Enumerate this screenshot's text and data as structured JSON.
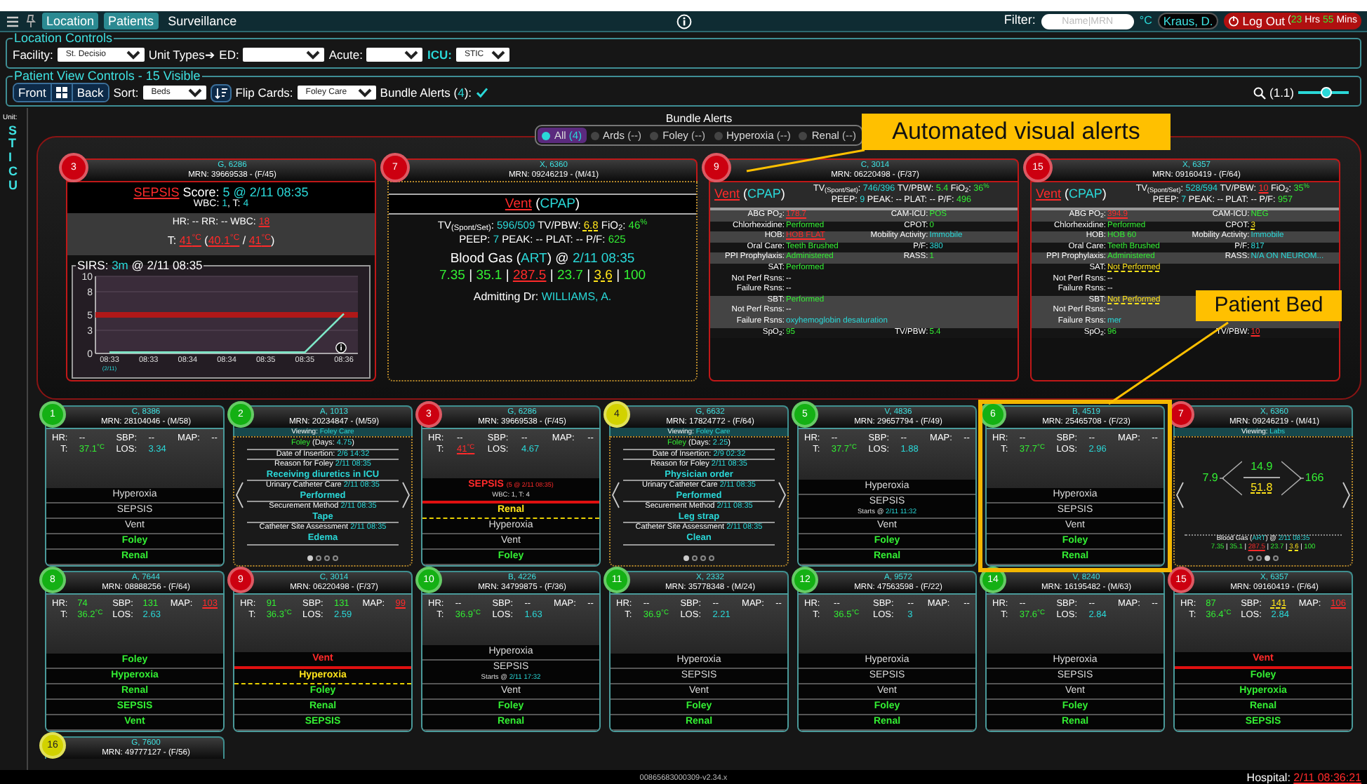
{
  "topbar": {
    "tabs": [
      {
        "label": "Location",
        "selected": true
      },
      {
        "label": "Patients",
        "selected": true
      },
      {
        "label": "Surveillance",
        "selected": false
      }
    ],
    "filter": {
      "label": "Filter:",
      "placeholder": "Name|MRN"
    },
    "temperature_unit": "°C",
    "user": "Kraus, D.",
    "logout": {
      "label": "Log Out",
      "session": [
        {
          "text": "(",
          "kind": "plain"
        },
        {
          "text": "23",
          "kind": "ok"
        },
        {
          "text": " Hrs ",
          "kind": "plain"
        },
        {
          "text": "55",
          "kind": "ok"
        },
        {
          "text": " Mins",
          "kind": "plain"
        }
      ]
    }
  },
  "location_controls": {
    "legend": "Location Controls",
    "fields": [
      {
        "label": "Facility:",
        "value": "St. Decisio",
        "highlighted": false
      },
      {
        "label": "Unit Types➔ ED:",
        "highlighted": false
      },
      {
        "label": "Acute:",
        "highlighted": false
      },
      {
        "label": "ICU:",
        "value": "STIC",
        "highlighted": true
      }
    ]
  },
  "view_controls": {
    "legend": "Patient View Controls - 15 Visible",
    "front": "Front",
    "back": "Back",
    "sort": {
      "label": "Sort:",
      "value": "Beds"
    },
    "flip": {
      "label": "Flip Cards:",
      "value": "Foley Care"
    },
    "bundle_alerts": {
      "label": [
        {
          "text": "Bundle Alerts (",
          "kind": "plain"
        },
        {
          "text": "4",
          "kind": "info"
        },
        {
          "text": "):",
          "kind": "plain"
        }
      ],
      "checked": true
    },
    "zoom": {
      "label": "(1.1)",
      "level": 0.55
    }
  },
  "unit": {
    "label": "Unit:",
    "name": "STICU"
  },
  "bundle_alerts": {
    "title": "Bundle Alerts",
    "filters": [
      {
        "label": "All",
        "count": "(4)",
        "selected": true
      },
      {
        "label": "Ards",
        "count": "(--)",
        "selected": false
      },
      {
        "label": "Foley",
        "count": "(--)",
        "selected": false
      },
      {
        "label": "Hyperoxia",
        "count": "(--)",
        "selected": false
      },
      {
        "label": "Renal",
        "count": "(--)",
        "selected": false
      }
    ],
    "cards": [
      {
        "bed": "3",
        "color": "#cc0010",
        "name": "G, 6286",
        "mrn": "MRN: 39669538 - (F/45)",
        "kind": "sepsis",
        "summary": [
          [
            {
              "text": "SEPSIS",
              "kind": "alert"
            },
            {
              "text": " Score: ",
              "kind": "plain"
            },
            {
              "text": "5 @ 2/11 08:35",
              "kind": "info"
            }
          ],
          [
            {
              "text": "WBC: ",
              "kind": "plain"
            },
            {
              "text": "1",
              "kind": "info"
            },
            {
              "text": ", T: ",
              "kind": "plain"
            },
            {
              "text": "4",
              "kind": "info"
            }
          ]
        ],
        "details": [
          [
            {
              "text": "HR: -- RR: -- WBC: ",
              "kind": "plain"
            },
            {
              "text": "18",
              "kind": "alert"
            }
          ],
          [
            {
              "text": "T: ",
              "kind": "plain"
            },
            {
              "text": "41$^{°C}$",
              "kind": "alert"
            },
            {
              "text": " (",
              "kind": "plain"
            },
            {
              "text": "40.1$^{°C}$",
              "kind": "alert"
            },
            {
              "text": " / ",
              "kind": "plain"
            },
            {
              "text": "41$^{°C}$",
              "kind": "alert"
            },
            {
              "text": ")",
              "kind": "plain"
            }
          ]
        ],
        "sirs": {
          "title": [
            {
              "text": "SIRS: ",
              "kind": "plain"
            },
            {
              "text": "3m",
              "kind": "info"
            },
            {
              "text": " @ 2/11 08:35",
              "kind": "plain"
            }
          ],
          "chart_data": {
            "type": "line",
            "xlabel": "(2/11)",
            "categories": [
              "08:33",
              "08:33",
              "08:34",
              "08:34",
              "08:35",
              "08:35",
              "08:36"
            ],
            "series": [
              {
                "color": "#7ee8c8",
                "values": [
                  0,
                  0,
                  0,
                  0,
                  0,
                  0,
                  5
                ]
              }
            ],
            "ylim": [
              0,
              10
            ],
            "yticks": [
              0,
              3,
              5,
              8,
              10
            ]
          }
        }
      },
      {
        "bed": "7",
        "color": "#cc0010",
        "name": "X, 6360",
        "mrn": "MRN: 09246219 - (M/41)",
        "kind": "vent_summary",
        "heading": [
          {
            "text": "Vent",
            "kind": "alert"
          },
          {
            "text": " (",
            "kind": "plain"
          },
          {
            "text": "CPAP",
            "kind": "info"
          },
          {
            "text": ")",
            "kind": "plain"
          }
        ],
        "settings": [
          [
            {
              "text": "TV$_{(Spont/Set)}$: ",
              "kind": "plain"
            },
            {
              "text": "596/509",
              "kind": "info"
            },
            {
              "text": " TV/PBW: ",
              "kind": "plain"
            },
            {
              "text": "6.8",
              "kind": "warn"
            },
            {
              "text": " FiO$_{2}$: ",
              "kind": "plain"
            },
            {
              "text": "46$^{%}$",
              "kind": "ok"
            }
          ],
          [
            {
              "text": "PEEP: ",
              "kind": "plain"
            },
            {
              "text": "7",
              "kind": "info"
            },
            {
              "text": " PEAK: -- PLAT: -- P/F: ",
              "kind": "plain"
            },
            {
              "text": "625",
              "kind": "ok"
            }
          ]
        ],
        "blood_gas": {
          "title": [
            {
              "text": "Blood Gas (",
              "kind": "plain"
            },
            {
              "text": "ART",
              "kind": "info"
            },
            {
              "text": ") @ ",
              "kind": "plain"
            },
            {
              "text": "2/11 08:35",
              "kind": "info"
            }
          ],
          "values": [
            {
              "text": "7.35",
              "kind": "ok"
            },
            {
              "text": " | ",
              "kind": "plain"
            },
            {
              "text": "35.1",
              "kind": "ok"
            },
            {
              "text": " | ",
              "kind": "plain"
            },
            {
              "text": "287.5",
              "kind": "alert"
            },
            {
              "text": " | ",
              "kind": "plain"
            },
            {
              "text": "23.7",
              "kind": "ok"
            },
            {
              "text": " | ",
              "kind": "plain"
            },
            {
              "text": "3.6",
              "kind": "warn"
            },
            {
              "text": " | ",
              "kind": "plain"
            },
            {
              "text": "100",
              "kind": "ok"
            }
          ]
        },
        "admitting": [
          {
            "text": "Admitting Dr: ",
            "kind": "plain"
          },
          {
            "text": "WILLIAMS, A.",
            "kind": "info"
          }
        ]
      },
      {
        "bed": "9",
        "color": "#cc0010",
        "name": "C, 3014",
        "mrn": "MRN: 06220498 - (F/37)",
        "kind": "vent_bundle",
        "heading": [
          {
            "text": "Vent",
            "kind": "alert"
          },
          {
            "text": " (",
            "kind": "plain"
          },
          {
            "text": "CPAP",
            "kind": "info"
          },
          {
            "text": ")",
            "kind": "plain"
          }
        ],
        "settings": [
          [
            {
              "text": "TV$_{(Spont/Set)}$: ",
              "kind": "plain"
            },
            {
              "text": "746/396",
              "kind": "info"
            },
            {
              "text": " TV/PBW: ",
              "kind": "plain"
            },
            {
              "text": "5.4",
              "kind": "ok"
            },
            {
              "text": " FiO$_{2}$: ",
              "kind": "plain"
            },
            {
              "text": "36$^{%}$",
              "kind": "ok"
            }
          ],
          [
            {
              "text": "PEEP: ",
              "kind": "plain"
            },
            {
              "text": "9",
              "kind": "info"
            },
            {
              "text": " PEAK: -- PLAT: -- P/F: ",
              "kind": "plain"
            },
            {
              "text": "496",
              "kind": "ok"
            }
          ]
        ],
        "sections": [
          [
            [
              {
                "label": "ABG PO$_{2}$:",
                "value": "178.7",
                "kind": "alert"
              },
              {
                "label": "CAM-ICU:",
                "value": "POS",
                "kind": "ok"
              }
            ]
          ],
          [
            [
              {
                "label": "Chlorhexidine:",
                "value": "Performed",
                "kind": "ok"
              },
              {
                "label": "CPOT:",
                "value": "0",
                "kind": "ok"
              }
            ]
          ],
          [
            [
              {
                "label": "HOB:",
                "value": "HOB FLAT",
                "kind": "alert"
              },
              {
                "label": "Mobility Activity:",
                "value": "Immobile",
                "kind": "info"
              }
            ]
          ],
          [
            [
              {
                "label": "Oral Care:",
                "value": "Teeth Brushed",
                "kind": "ok"
              },
              {
                "label": "P/F:",
                "value": "380",
                "kind": "info"
              }
            ]
          ],
          [
            [
              {
                "label": "PPI Prophylaxis:",
                "value": "Administered",
                "kind": "ok"
              },
              {
                "label": "RASS:",
                "value": "1",
                "kind": "ok"
              }
            ]
          ],
          [
            [
              {
                "label": "SAT:",
                "value": "Performed",
                "kind": "ok"
              }
            ],
            [
              {
                "label": "Not Perf Rsns:",
                "value": "--",
                "kind": "plain"
              }
            ],
            [
              {
                "label": "Failure Rsns:",
                "value": "--",
                "kind": "plain"
              }
            ]
          ],
          [
            [
              {
                "label": "SBT:",
                "value": "Performed",
                "kind": "ok"
              }
            ],
            [
              {
                "label": "Not Perf Rsns:",
                "value": "--",
                "kind": "plain"
              }
            ],
            [
              {
                "label": "Failure Rsns:",
                "value": "oxyhemoglobin desaturation",
                "kind": "info"
              }
            ]
          ],
          [
            [
              {
                "label": "SpO$_{2}$:",
                "value": "95",
                "kind": "ok"
              },
              {
                "label": "TV/PBW:",
                "value": "5.4",
                "kind": "ok"
              }
            ]
          ]
        ]
      },
      {
        "bed": "15",
        "color": "#cc0010",
        "name": "X, 6357",
        "mrn": "MRN: 09160419 - (F/64)",
        "kind": "vent_bundle",
        "heading": [
          {
            "text": "Vent",
            "kind": "alert"
          },
          {
            "text": " (",
            "kind": "plain"
          },
          {
            "text": "CPAP",
            "kind": "info"
          },
          {
            "text": ")",
            "kind": "plain"
          }
        ],
        "settings": [
          [
            {
              "text": "TV$_{(Spont/Set)}$: ",
              "kind": "plain"
            },
            {
              "text": "528/594",
              "kind": "info"
            },
            {
              "text": " TV/PBW: ",
              "kind": "plain"
            },
            {
              "text": "10",
              "kind": "alert"
            },
            {
              "text": " FiO$_{2}$: ",
              "kind": "plain"
            },
            {
              "text": "35$^{%}$",
              "kind": "ok"
            }
          ],
          [
            {
              "text": "PEEP: ",
              "kind": "plain"
            },
            {
              "text": "7",
              "kind": "info"
            },
            {
              "text": " PEAK: -- PLAT: -- P/F: ",
              "kind": "plain"
            },
            {
              "text": "957",
              "kind": "ok"
            }
          ]
        ],
        "sections": [
          [
            [
              {
                "label": "ABG PO$_{2}$:",
                "value": "394.9",
                "kind": "alert"
              },
              {
                "label": "CAM-ICU:",
                "value": "NEG",
                "kind": "ok"
              }
            ]
          ],
          [
            [
              {
                "label": "Chlorhexidine:",
                "value": "Performed",
                "kind": "ok"
              },
              {
                "label": "CPOT:",
                "value": "3",
                "kind": "warn"
              }
            ]
          ],
          [
            [
              {
                "label": "HOB:",
                "value": "HOB 60",
                "kind": "ok"
              },
              {
                "label": "Mobility Activity:",
                "value": "Immobile",
                "kind": "info"
              }
            ]
          ],
          [
            [
              {
                "label": "Oral Care:",
                "value": "Teeth Brushed",
                "kind": "ok"
              },
              {
                "label": "P/F:",
                "value": "817",
                "kind": "info"
              }
            ]
          ],
          [
            [
              {
                "label": "PPI Prophylaxis:",
                "value": "Administered",
                "kind": "ok"
              },
              {
                "label": "RASS:",
                "value": "N/A ON NEUROM...",
                "kind": "info"
              }
            ]
          ],
          [
            [
              {
                "label": "SAT:",
                "value": "Not Performed",
                "kind": "warn"
              }
            ],
            [
              {
                "label": "Not Perf Rsns:",
                "value": "--",
                "kind": "plain"
              }
            ],
            [
              {
                "label": "Failure Rsns:",
                "value": "--",
                "kind": "plain"
              }
            ]
          ],
          [
            [
              {
                "label": "SBT:",
                "value": "Not Performed",
                "kind": "warn"
              }
            ],
            [
              {
                "label": "Not Perf Rsns:",
                "value": "--",
                "kind": "plain"
              }
            ],
            [
              {
                "label": "Failure Rsns:",
                "value": "mer",
                "kind": "info"
              }
            ]
          ],
          [
            [
              {
                "label": "SpO$_{2}$:",
                "value": "96",
                "kind": "ok"
              },
              {
                "label": "TV/PBW:",
                "value": "10",
                "kind": "alert"
              }
            ]
          ]
        ]
      }
    ]
  },
  "patients": [
    {
      "bed": "1",
      "color": "#14b014",
      "name": "C, 8386",
      "mrn": "MRN: 28104046 - (M/58)",
      "highlighted": false,
      "kind": "vitals",
      "vitals": [
        {
          "label": "HR:",
          "value": "--",
          "kind": "plain"
        },
        {
          "label": "SBP:",
          "value": "--",
          "kind": "plain"
        },
        {
          "label": "MAP:",
          "value": "--",
          "kind": "plain"
        },
        {
          "label": "T:",
          "value": "37.1$^{°C}$",
          "kind": "ok"
        },
        {
          "label": "LOS:",
          "value": "3.34",
          "kind": "info"
        }
      ],
      "alerts": [
        {
          "text": "Hyperoxia",
          "kind": "plain"
        },
        {
          "text": "SEPSIS",
          "kind": "plain"
        },
        {
          "text": "Vent",
          "kind": "plain"
        },
        {
          "text": "Foley",
          "kind": "ok"
        },
        {
          "text": "Renal",
          "kind": "ok"
        }
      ]
    },
    {
      "bed": "2",
      "color": "#14b014",
      "name": "A, 1013",
      "mrn": "MRN: 20234847 - (M/59)",
      "highlighted": false,
      "viewing": [
        {
          "text": "Viewing: ",
          "kind": "plain"
        },
        {
          "text": "Foley Care",
          "kind": "info"
        }
      ],
      "kind": "foley",
      "entries": [
        {
          "label": [
            {
              "text": "Foley",
              "kind": "ok"
            },
            {
              "text": " (Days: ",
              "kind": "plain"
            },
            {
              "text": "4.75",
              "kind": "info"
            },
            {
              "text": ")",
              "kind": "plain"
            }
          ]
        },
        {
          "label": [
            {
              "text": "Date of Insertion: ",
              "kind": "plain"
            },
            {
              "text": "2/6 14:32",
              "kind": "info"
            }
          ]
        },
        {
          "label": [
            {
              "text": "Reason for Foley ",
              "kind": "plain"
            },
            {
              "text": "2/11 08:35",
              "kind": "info"
            }
          ],
          "value": "Receiving diuretics in ICU"
        },
        {
          "label": [
            {
              "text": "Urinary Catheter Care ",
              "kind": "plain"
            },
            {
              "text": "2/11 08:35",
              "kind": "info"
            }
          ],
          "value": "Performed"
        },
        {
          "label": [
            {
              "text": "Securement Method ",
              "kind": "plain"
            },
            {
              "text": "2/11 08:35",
              "kind": "info"
            }
          ],
          "value": "Tape"
        },
        {
          "label": [
            {
              "text": "Catheter Site Assessment ",
              "kind": "plain"
            },
            {
              "text": "2/11 08:35",
              "kind": "info"
            }
          ],
          "value": "Edema"
        }
      ],
      "pages": [
        {
          "selected": true
        },
        {
          "selected": false
        },
        {
          "selected": false
        },
        {
          "selected": false
        }
      ]
    },
    {
      "bed": "3",
      "color": "#cc0010",
      "name": "G, 6286",
      "mrn": "MRN: 39669538 - (F/45)",
      "highlighted": false,
      "kind": "vitals",
      "vitals": [
        {
          "label": "HR:",
          "value": "--",
          "kind": "plain"
        },
        {
          "label": "SBP:",
          "value": "--",
          "kind": "plain"
        },
        {
          "label": "MAP:",
          "value": "--",
          "kind": "plain"
        },
        {
          "label": "T:",
          "value": "41$^{°C}$",
          "kind": "alert"
        },
        {
          "label": "LOS:",
          "value": "4.67",
          "kind": "info"
        }
      ],
      "alerts": [
        {
          "text": "SEPSIS",
          "kind": "alert",
          "note": "(5 @ 2/11 08:35)",
          "detail": [
            {
              "text": "WBC: 1, T: 4",
              "kind": "plain"
            }
          ]
        },
        {
          "text": "Renal",
          "kind": "warn"
        },
        {
          "text": "Hyperoxia",
          "kind": "plain"
        },
        {
          "text": "Vent",
          "kind": "plain"
        },
        {
          "text": "Foley",
          "kind": "ok"
        }
      ]
    },
    {
      "bed": "4",
      "color": "#d2d200",
      "name": "G, 6632",
      "mrn": "MRN: 17824772 - (F/64)",
      "highlighted": false,
      "viewing": [
        {
          "text": "Viewing: ",
          "kind": "plain"
        },
        {
          "text": "Foley Care",
          "kind": "info"
        }
      ],
      "kind": "foley",
      "entries": [
        {
          "label": [
            {
              "text": "Foley",
              "kind": "ok"
            },
            {
              "text": " (Days: ",
              "kind": "plain"
            },
            {
              "text": "2.25",
              "kind": "info"
            },
            {
              "text": ")",
              "kind": "plain"
            }
          ]
        },
        {
          "label": [
            {
              "text": "Date of Insertion: ",
              "kind": "plain"
            },
            {
              "text": "2/9 02:32",
              "kind": "info"
            }
          ]
        },
        {
          "label": [
            {
              "text": "Reason for Foley ",
              "kind": "plain"
            },
            {
              "text": "2/11 08:35",
              "kind": "info"
            }
          ],
          "value": "Physician order"
        },
        {
          "label": [
            {
              "text": "Urinary Catheter Care ",
              "kind": "plain"
            },
            {
              "text": "2/11 08:35",
              "kind": "info"
            }
          ],
          "value": "Performed"
        },
        {
          "label": [
            {
              "text": "Securement Method ",
              "kind": "plain"
            },
            {
              "text": "2/11 08:35",
              "kind": "info"
            }
          ],
          "value": "Leg strap"
        },
        {
          "label": [
            {
              "text": "Catheter Site Assessment ",
              "kind": "plain"
            },
            {
              "text": "2/11 08:35",
              "kind": "info"
            }
          ],
          "value": "Clean"
        }
      ],
      "pages": [
        {
          "selected": true
        },
        {
          "selected": false
        },
        {
          "selected": false
        },
        {
          "selected": false
        }
      ]
    },
    {
      "bed": "5",
      "color": "#14b014",
      "name": "V, 4836",
      "mrn": "MRN: 29657794 - (F/49)",
      "highlighted": false,
      "kind": "vitals",
      "vitals": [
        {
          "label": "HR:",
          "value": "--",
          "kind": "plain"
        },
        {
          "label": "SBP:",
          "value": "--",
          "kind": "plain"
        },
        {
          "label": "MAP:",
          "value": "--",
          "kind": "plain"
        },
        {
          "label": "T:",
          "value": "37.7$^{°C}$",
          "kind": "ok"
        },
        {
          "label": "LOS:",
          "value": "1.88",
          "kind": "info"
        }
      ],
      "alerts": [
        {
          "text": "Hyperoxia",
          "kind": "plain"
        },
        {
          "text": "SEPSIS",
          "kind": "plain",
          "detail": [
            {
              "text": "Starts @ ",
              "kind": "plain"
            },
            {
              "text": "2/11 11:32",
              "kind": "info"
            }
          ]
        },
        {
          "text": "Vent",
          "kind": "plain"
        },
        {
          "text": "Foley",
          "kind": "ok"
        },
        {
          "text": "Renal",
          "kind": "ok"
        }
      ]
    },
    {
      "bed": "6",
      "color": "#14b014",
      "name": "B, 4519",
      "mrn": "MRN: 25465708 - (F/23)",
      "highlighted": true,
      "kind": "vitals",
      "vitals": [
        {
          "label": "HR:",
          "value": "--",
          "kind": "plain"
        },
        {
          "label": "SBP:",
          "value": "--",
          "kind": "plain"
        },
        {
          "label": "MAP:",
          "value": "--",
          "kind": "plain"
        },
        {
          "label": "T:",
          "value": "37.7$^{°C}$",
          "kind": "ok"
        },
        {
          "label": "LOS:",
          "value": "2.96",
          "kind": "info"
        }
      ],
      "alerts": [
        {
          "text": "Hyperoxia",
          "kind": "plain"
        },
        {
          "text": "SEPSIS",
          "kind": "plain"
        },
        {
          "text": "Vent",
          "kind": "plain"
        },
        {
          "text": "Foley",
          "kind": "ok"
        },
        {
          "text": "Renal",
          "kind": "ok"
        }
      ]
    },
    {
      "bed": "7",
      "color": "#cc0010",
      "name": "X, 6360",
      "mrn": "MRN: 09246219 - (M/41)",
      "highlighted": false,
      "viewing": [
        {
          "text": "Viewing: ",
          "kind": "plain"
        },
        {
          "text": "Labs",
          "kind": "info"
        }
      ],
      "kind": "labs",
      "labs": {
        "left": {
          "text": "7.9",
          "kind": "ok"
        },
        "top": {
          "text": "14.9",
          "kind": "ok"
        },
        "bottom": {
          "text": "51.8",
          "kind": "warn"
        },
        "right": {
          "text": "166",
          "kind": "ok"
        }
      },
      "blood_gas": {
        "title": [
          {
            "text": "Blood Gas (",
            "kind": "plain"
          },
          {
            "text": "ART",
            "kind": "info"
          },
          {
            "text": ") @ ",
            "kind": "plain"
          },
          {
            "text": "2/11 08:35",
            "kind": "info"
          }
        ],
        "values": [
          {
            "text": "7.35",
            "kind": "ok"
          },
          {
            "text": " | ",
            "kind": "plain"
          },
          {
            "text": "35.1",
            "kind": "ok"
          },
          {
            "text": " | ",
            "kind": "plain"
          },
          {
            "text": "287.5",
            "kind": "alert"
          },
          {
            "text": " | ",
            "kind": "plain"
          },
          {
            "text": "23.7",
            "kind": "ok"
          },
          {
            "text": " | ",
            "kind": "plain"
          },
          {
            "text": "3.6",
            "kind": "warn"
          },
          {
            "text": " | ",
            "kind": "plain"
          },
          {
            "text": "100",
            "kind": "ok"
          }
        ]
      },
      "pages": [
        {
          "selected": false
        },
        {
          "selected": false
        },
        {
          "selected": true
        },
        {
          "selected": false
        }
      ]
    },
    {
      "bed": "8",
      "color": "#14b014",
      "name": "A, 7644",
      "mrn": "MRN: 08888256 - (F/64)",
      "highlighted": false,
      "kind": "vitals",
      "vitals": [
        {
          "label": "HR:",
          "value": "74",
          "kind": "ok"
        },
        {
          "label": "SBP:",
          "value": "131",
          "kind": "ok"
        },
        {
          "label": "MAP:",
          "value": "103",
          "kind": "alert"
        },
        {
          "label": "T:",
          "value": "36.2$^{°C}$",
          "kind": "ok"
        },
        {
          "label": "LOS:",
          "value": "2.63",
          "kind": "info"
        }
      ],
      "alerts": [
        {
          "text": "Foley",
          "kind": "ok"
        },
        {
          "text": "Hyperoxia",
          "kind": "ok"
        },
        {
          "text": "Renal",
          "kind": "ok"
        },
        {
          "text": "SEPSIS",
          "kind": "ok"
        },
        {
          "text": "Vent",
          "kind": "ok"
        }
      ]
    },
    {
      "bed": "9",
      "color": "#cc0010",
      "name": "C, 3014",
      "mrn": "MRN: 06220498 - (F/37)",
      "highlighted": false,
      "kind": "vitals",
      "vitals": [
        {
          "label": "HR:",
          "value": "91",
          "kind": "ok"
        },
        {
          "label": "SBP:",
          "value": "131",
          "kind": "ok"
        },
        {
          "label": "MAP:",
          "value": "99",
          "kind": "alert"
        },
        {
          "label": "T:",
          "value": "36.3$^{°C}$",
          "kind": "ok"
        },
        {
          "label": "LOS:",
          "value": "2.59",
          "kind": "info"
        }
      ],
      "alerts": [
        {
          "text": "Vent",
          "kind": "alert"
        },
        {
          "text": "Hyperoxia",
          "kind": "warn"
        },
        {
          "text": "Foley",
          "kind": "ok"
        },
        {
          "text": "Renal",
          "kind": "ok"
        },
        {
          "text": "SEPSIS",
          "kind": "ok"
        }
      ]
    },
    {
      "bed": "10",
      "color": "#14b014",
      "name": "B, 4226",
      "mrn": "MRN: 34799875 - (F/36)",
      "highlighted": false,
      "kind": "vitals",
      "vitals": [
        {
          "label": "HR:",
          "value": "--",
          "kind": "plain"
        },
        {
          "label": "SBP:",
          "value": "--",
          "kind": "plain"
        },
        {
          "label": "MAP:",
          "value": "--",
          "kind": "plain"
        },
        {
          "label": "T:",
          "value": "36.9$^{°C}$",
          "kind": "ok"
        },
        {
          "label": "LOS:",
          "value": "1.63",
          "kind": "info"
        }
      ],
      "alerts": [
        {
          "text": "Hyperoxia",
          "kind": "plain"
        },
        {
          "text": "SEPSIS",
          "kind": "plain",
          "detail": [
            {
              "text": "Starts @ ",
              "kind": "plain"
            },
            {
              "text": "2/11 17:32",
              "kind": "info"
            }
          ]
        },
        {
          "text": "Vent",
          "kind": "plain"
        },
        {
          "text": "Foley",
          "kind": "ok"
        },
        {
          "text": "Renal",
          "kind": "ok"
        }
      ]
    },
    {
      "bed": "11",
      "color": "#14b014",
      "name": "X, 2332",
      "mrn": "MRN: 35778348 - (M/24)",
      "highlighted": false,
      "kind": "vitals",
      "vitals": [
        {
          "label": "HR:",
          "value": "--",
          "kind": "plain"
        },
        {
          "label": "SBP:",
          "value": "--",
          "kind": "plain"
        },
        {
          "label": "MAP:",
          "value": "--",
          "kind": "plain"
        },
        {
          "label": "T:",
          "value": "36.9$^{°C}$",
          "kind": "ok"
        },
        {
          "label": "LOS:",
          "value": "2.21",
          "kind": "info"
        }
      ],
      "alerts": [
        {
          "text": "Hyperoxia",
          "kind": "plain"
        },
        {
          "text": "SEPSIS",
          "kind": "plain"
        },
        {
          "text": "Vent",
          "kind": "plain"
        },
        {
          "text": "Foley",
          "kind": "ok"
        },
        {
          "text": "Renal",
          "kind": "ok"
        }
      ]
    },
    {
      "bed": "12",
      "color": "#14b014",
      "name": "A, 9572",
      "mrn": "MRN: 47563598 - (F/22)",
      "highlighted": false,
      "kind": "vitals",
      "vitals": [
        {
          "label": "HR:",
          "value": "--",
          "kind": "plain"
        },
        {
          "label": "SBP:",
          "value": "--",
          "kind": "plain"
        },
        {
          "label": "MAP:",
          "value": "--",
          "kind": "plain"
        },
        {
          "label": "T:",
          "value": "36.5$^{°C}$",
          "kind": "ok"
        },
        {
          "label": "LOS:",
          "value": "3",
          "kind": "info"
        }
      ],
      "alerts": [
        {
          "text": "Hyperoxia",
          "kind": "plain"
        },
        {
          "text": "SEPSIS",
          "kind": "plain"
        },
        {
          "text": "Vent",
          "kind": "plain"
        },
        {
          "text": "Foley",
          "kind": "ok"
        },
        {
          "text": "Renal",
          "kind": "ok"
        }
      ]
    },
    {
      "bed": "14",
      "color": "#14b014",
      "name": "V, 8240",
      "mrn": "MRN: 16195482 - (M/63)",
      "highlighted": false,
      "kind": "vitals",
      "vitals": [
        {
          "label": "HR:",
          "value": "--",
          "kind": "plain"
        },
        {
          "label": "SBP:",
          "value": "--",
          "kind": "plain"
        },
        {
          "label": "MAP:",
          "value": "--",
          "kind": "plain"
        },
        {
          "label": "T:",
          "value": "37.6$^{°C}$",
          "kind": "ok"
        },
        {
          "label": "LOS:",
          "value": "2.84",
          "kind": "info"
        }
      ],
      "alerts": [
        {
          "text": "Hyperoxia",
          "kind": "plain"
        },
        {
          "text": "SEPSIS",
          "kind": "plain"
        },
        {
          "text": "Vent",
          "kind": "plain"
        },
        {
          "text": "Foley",
          "kind": "ok"
        },
        {
          "text": "Renal",
          "kind": "ok"
        }
      ]
    },
    {
      "bed": "15",
      "color": "#cc0010",
      "name": "X, 6357",
      "mrn": "MRN: 09160419 - (F/64)",
      "highlighted": false,
      "kind": "vitals",
      "vitals": [
        {
          "label": "HR:",
          "value": "87",
          "kind": "ok"
        },
        {
          "label": "SBP:",
          "value": "141",
          "kind": "warn"
        },
        {
          "label": "MAP:",
          "value": "106",
          "kind": "alert"
        },
        {
          "label": "T:",
          "value": "36.4$^{°C}$",
          "kind": "ok"
        },
        {
          "label": "LOS:",
          "value": "2.84",
          "kind": "info"
        }
      ],
      "alerts": [
        {
          "text": "Vent",
          "kind": "alert"
        },
        {
          "text": "Foley",
          "kind": "ok"
        },
        {
          "text": "Hyperoxia",
          "kind": "ok"
        },
        {
          "text": "Renal",
          "kind": "ok"
        },
        {
          "text": "SEPSIS",
          "kind": "ok"
        }
      ]
    },
    {
      "bed": "16",
      "color": "#d2d200",
      "name": "G, 7600",
      "mrn": "MRN: 49777127 - (F/56)",
      "highlighted": false,
      "kind": "header_only"
    }
  ],
  "footer": {
    "build": "00865683000309-v2.34.x",
    "clock": [
      {
        "text": "Hospital: ",
        "kind": "plain"
      },
      {
        "text": "2/11 08:36:21",
        "kind": "alert"
      }
    ]
  },
  "callouts": [
    {
      "text": "Automated visual alerts"
    },
    {
      "text": "Patient Bed"
    }
  ]
}
